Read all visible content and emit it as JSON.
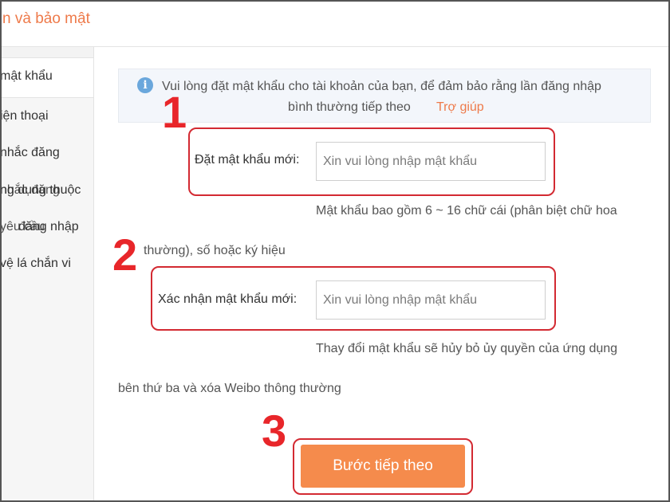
{
  "header": {
    "title": "n và bảo mật"
  },
  "sidebar": {
    "items": [
      {
        "label": "mật khẩu"
      },
      {
        "label": "iện thoại"
      },
      {
        "label": "nhắc đăng"
      }
    ],
    "overlap_rows": [
      {
        "text_a": "ng dụng thuộc",
        "text_b": "nhắc đăng"
      },
      {
        "text_a": "đăng nhập",
        "text_b": "yêu cầu"
      }
    ],
    "last_item": {
      "label": "vệ lá chắn vi"
    }
  },
  "info": {
    "line1": "Vui lòng đặt mật khẩu cho tài khoản của bạn, để đảm bảo rằng lần đăng nhập",
    "line2": "bình thường tiếp theo",
    "help_link": "Trợ giúp"
  },
  "form": {
    "new_password": {
      "label": "Đặt mật khẩu mới:",
      "placeholder": "Xin vui lòng nhập mật khẩu",
      "value": ""
    },
    "password_hint_line1": "Mật khẩu bao gồm 6 ~ 16 chữ cái (phân biệt chữ hoa",
    "password_hint_line2": "thường), số hoặc ký hiệu",
    "confirm_password": {
      "label": "Xác nhận mật khẩu mới:",
      "placeholder": "Xin vui lòng nhập mật khẩu",
      "value": ""
    },
    "warning_line1": "Thay đổi mật khẩu sẽ hủy bỏ ủy quyền của ứng dụng",
    "warning_line2": "bên thứ ba và xóa Weibo thông thường",
    "next_button": "Bước tiếp theo"
  },
  "annotations": {
    "step1": "1",
    "step2": "2",
    "step3": "3"
  },
  "colors": {
    "accent": "#f58b4c",
    "link": "#ee7a4a",
    "annotation": "#e8262a",
    "info_icon": "#6aa7dc"
  }
}
